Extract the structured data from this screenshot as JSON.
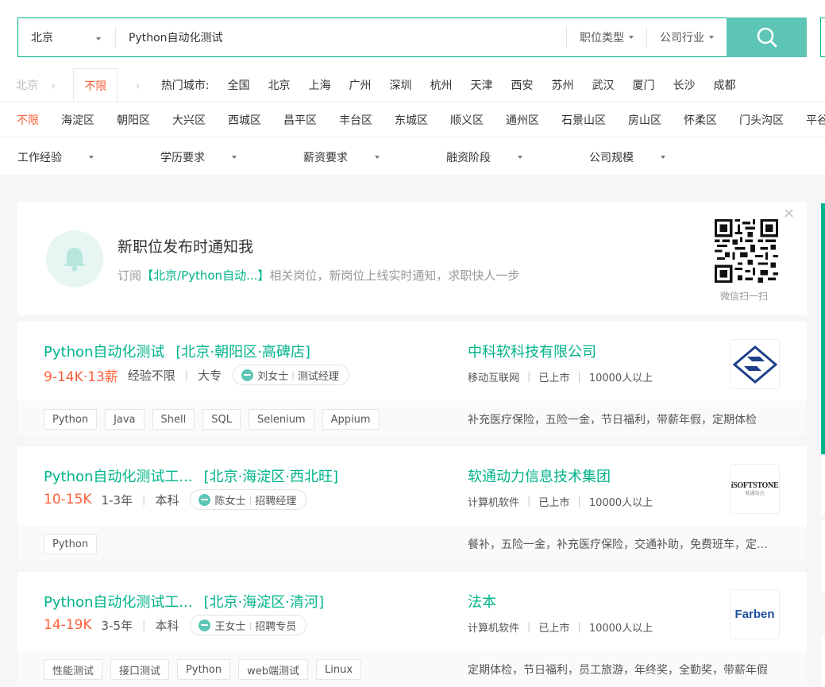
{
  "search": {
    "city": "北京",
    "query": "Python自动化测试",
    "dropdowns": [
      "职位类型",
      "公司行业"
    ],
    "button_icon": "search-icon"
  },
  "city_row": {
    "current": "北京",
    "active": "不限",
    "hot_label": "热门城市:",
    "cities": [
      "全国",
      "北京",
      "上海",
      "广州",
      "深圳",
      "杭州",
      "天津",
      "西安",
      "苏州",
      "武汉",
      "厦门",
      "长沙",
      "成都"
    ]
  },
  "district_row": {
    "active": "不限",
    "districts": [
      "海淀区",
      "朝阳区",
      "大兴区",
      "西城区",
      "昌平区",
      "丰台区",
      "东城区",
      "顺义区",
      "通州区",
      "石景山区",
      "房山区",
      "怀柔区",
      "门头沟区",
      "平谷区"
    ]
  },
  "filters": [
    "工作经验",
    "学历要求",
    "薪资要求",
    "融资阶段",
    "公司规模"
  ],
  "subscribe": {
    "title": "新职位发布时通知我",
    "desc_prefix": "订阅",
    "desc_highlight": "【北京/Python自动...】",
    "desc_suffix": "相关岗位，新岗位上线实时通知，求职快人一步",
    "qr_caption": "微信扫一扫",
    "close": "×"
  },
  "jobs": [
    {
      "title": "Python自动化测试",
      "location": "[北京·朝阳区·高碑店]",
      "salary": "9-14K·13薪",
      "experience": "经验不限",
      "education": "大专",
      "hr_name": "刘女士",
      "hr_role": "测试经理",
      "company": "中科软科技有限公司",
      "industry": "移动互联网",
      "stage": "已上市",
      "size": "10000人以上",
      "tags": [
        "Python",
        "Java",
        "Shell",
        "SQL",
        "Selenium",
        "Appium"
      ],
      "benefits": "补充医疗保险，五险一金，节日福利，带薪年假，定期体检"
    },
    {
      "title": "Python自动化测试工...",
      "location": "[北京·海淀区·西北旺]",
      "salary": "10-15K",
      "experience": "1-3年",
      "education": "本科",
      "hr_name": "陈女士",
      "hr_role": "招聘经理",
      "company": "软通动力信息技术集团",
      "industry": "计算机软件",
      "stage": "已上市",
      "size": "10000人以上",
      "tags": [
        "Python"
      ],
      "benefits": "餐补，五险一金，补充医疗保险，交通补助，免费班车，定期体检"
    },
    {
      "title": "Python自动化测试工...",
      "location": "[北京·海淀区·清河]",
      "salary": "14-19K",
      "experience": "3-5年",
      "education": "本科",
      "hr_name": "王女士",
      "hr_role": "招聘专员",
      "company": "法本",
      "industry": "计算机软件",
      "stage": "已上市",
      "size": "10000人以上",
      "tags": [
        "性能测试",
        "接口测试",
        "Python",
        "web端测试",
        "Linux"
      ],
      "benefits": "定期体检，节日福利，员工旅游，年终奖，全勤奖，带薪年假"
    }
  ],
  "logos": {
    "isoftstone_text": "iSOFTSTONE",
    "isoftstone_sub": "软通动力",
    "farben_text": "Farben"
  },
  "colors": {
    "accent": "#00b38a",
    "search_button": "#5cc5b5",
    "salary": "#fd5f39"
  }
}
